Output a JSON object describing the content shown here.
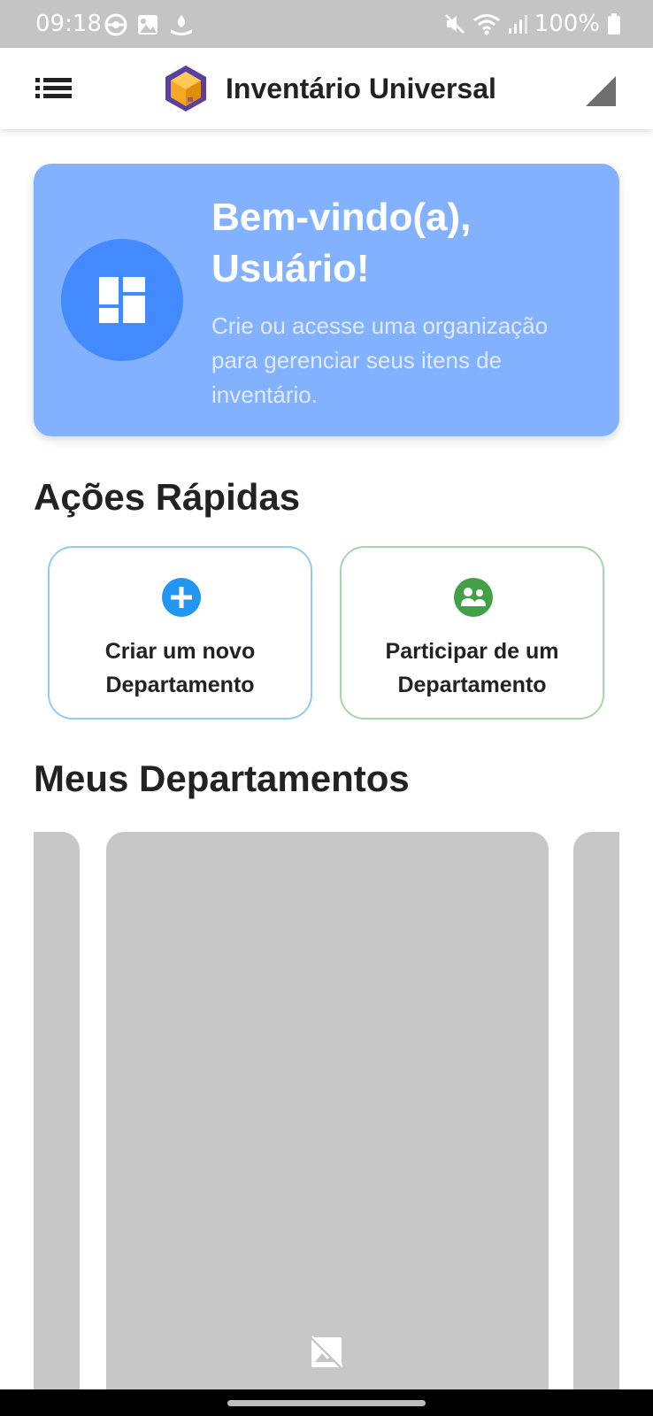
{
  "status_bar": {
    "time": "09:18",
    "battery": "100%",
    "left_icons": [
      "pokeball-icon",
      "gallery-icon",
      "bank-icon"
    ],
    "right_icons": [
      "mute-icon",
      "wifi-icon",
      "cell-signal-icon",
      "battery-icon"
    ]
  },
  "app_bar": {
    "title": "Inventário Universal",
    "menu_icon": "list-menu-icon",
    "logo_icon": "box-logo-icon"
  },
  "welcome": {
    "title": "Bem-vindo(a), Usuário!",
    "subtitle": "Crie ou acesse uma organização para gerenciar seus itens de inventário.",
    "icon": "dashboard-icon"
  },
  "quick_actions": {
    "title": "Ações Rápidas",
    "items": [
      {
        "label": "Criar um novo Departamento",
        "icon": "add-circle-icon",
        "color": "#2196f3"
      },
      {
        "label": "Participar de um Departamento",
        "icon": "group-icon",
        "color": "#43a047"
      }
    ]
  },
  "departments": {
    "title": "Meus Departamentos",
    "placeholder_icon": "broken-image-icon"
  },
  "colors": {
    "card_background": "#82b1ff",
    "avatar_background": "#448aff",
    "create_border": "#90caf9",
    "join_border": "#a5d6a7",
    "placeholder_gray": "#c7c7c7"
  }
}
